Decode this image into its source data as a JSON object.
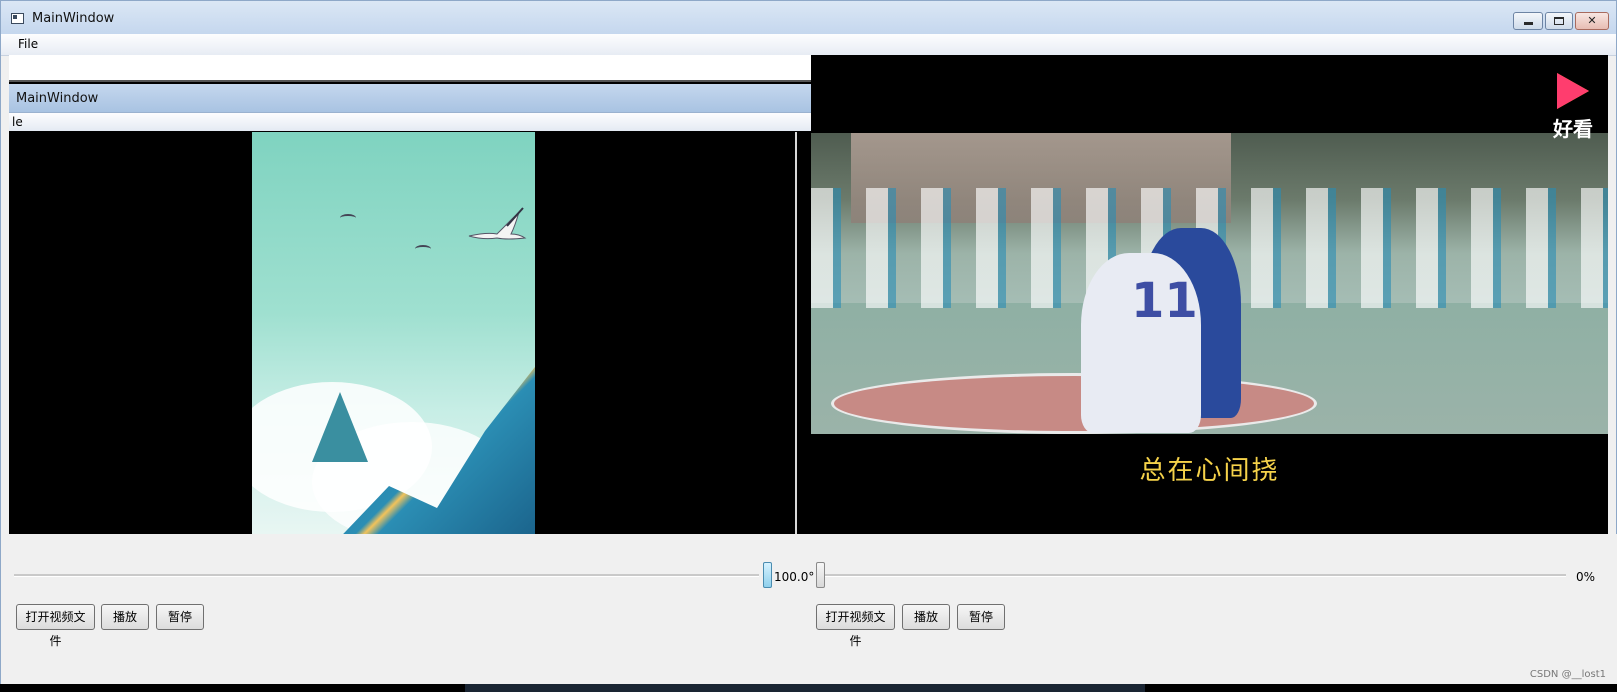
{
  "window": {
    "title": "MainWindow",
    "menu": [
      "File"
    ]
  },
  "embedded_window": {
    "title": "MainWindow",
    "menu_fragment": "le"
  },
  "left_player": {
    "progress_label": "100.0°",
    "progress_fraction": 1.0,
    "buttons": {
      "open": "打开视频文件",
      "play": "播放",
      "pause": "暂停"
    }
  },
  "right_player": {
    "logo_text": "好看",
    "subtitle": "总在心间挠",
    "jersey_number": "11",
    "progress_label": "0%",
    "progress_fraction": 0.0,
    "buttons": {
      "open": "打开视频文件",
      "play": "播放",
      "pause": "暂停"
    }
  },
  "watermark": "CSDN @__lost1",
  "colors": {
    "accent": "#8fd0ec",
    "subtitle": "#f5d24a",
    "logo": "#ff3d6e"
  },
  "icons": [
    "app-icon",
    "minimize-icon",
    "maximize-icon",
    "close-icon",
    "haokan-logo-icon"
  ]
}
